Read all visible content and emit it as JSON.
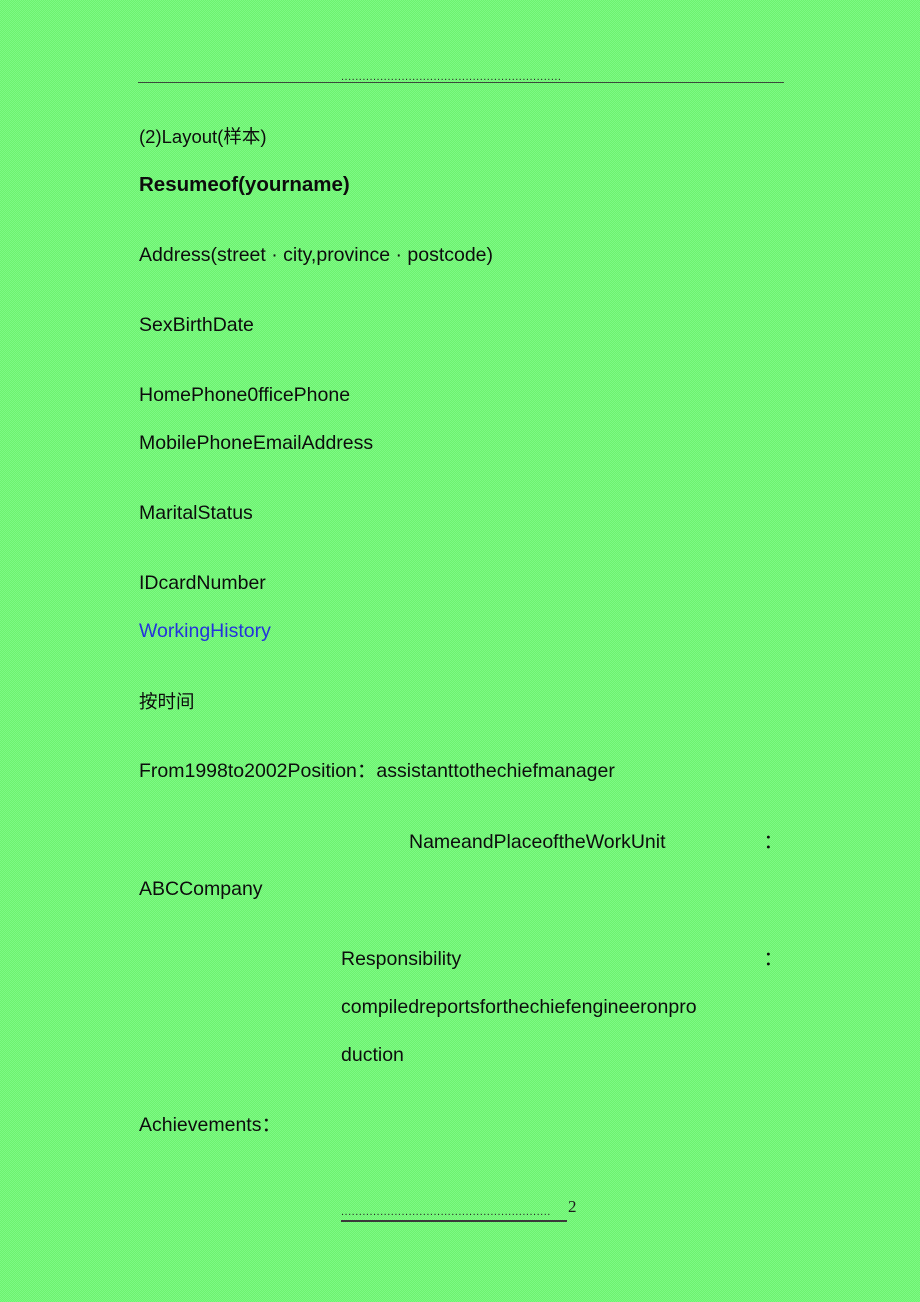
{
  "document": {
    "background_color": "#7dfa85",
    "text_color": "#0d0d0d",
    "link_color": "#2433dc",
    "rule_color": "#3c4a3c"
  },
  "header": {
    "leader_dots": "..............................................................",
    "rule": true
  },
  "body": {
    "section_label": "(2)Layout(样本)",
    "title": "Resumeof(yourname)",
    "address": "Address(street · city,province · postcode)",
    "sex_birth": "SexBirthDate",
    "home_office_phone": "HomePhone0fficePhone",
    "mobile_email": "MobilePhoneEmailAddress",
    "marital_status": "MaritalStatus",
    "id_card": "IDcardNumber",
    "working_history": "WorkingHistory",
    "sort_note": "按时间",
    "position_line": "From1998to2002Position：assistanttothechiefmanager",
    "work_unit_label": "NameandPlaceoftheWorkUnit",
    "work_unit_colon": "：",
    "work_unit_value": "ABCCompany",
    "responsibility_label": "Responsibility",
    "responsibility_colon": "：",
    "responsibility_value_line1": "compiledreportsforthechiefengineeronpro",
    "responsibility_value_line2": "duction",
    "achievements": "Achievements："
  },
  "footer": {
    "leader_dots": "...........................................................",
    "page_number": "2"
  }
}
